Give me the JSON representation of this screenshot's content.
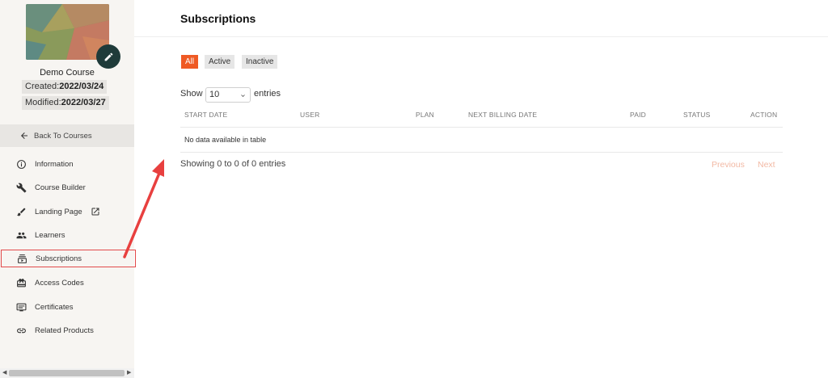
{
  "sidebar": {
    "course_name": "Demo Course",
    "created_label": "Created:",
    "created_date": "2022/03/24",
    "modified_label": "Modified:",
    "modified_date": "2022/03/27",
    "back_label": "Back To Courses",
    "items": [
      {
        "label": "Information",
        "icon": "info-icon"
      },
      {
        "label": "Course Builder",
        "icon": "wrench-icon"
      },
      {
        "label": "Landing Page",
        "icon": "brush-icon"
      },
      {
        "label": "Learners",
        "icon": "people-icon"
      },
      {
        "label": "Subscriptions",
        "icon": "subscriptions-icon"
      },
      {
        "label": "Access Codes",
        "icon": "ticket-icon"
      },
      {
        "label": "Certificates",
        "icon": "certificate-icon"
      },
      {
        "label": "Related Products",
        "icon": "link-icon"
      }
    ],
    "active_item": "Subscriptions"
  },
  "page": {
    "title": "Subscriptions"
  },
  "filters": [
    {
      "label": "All",
      "selected": true
    },
    {
      "label": "Active",
      "selected": false
    },
    {
      "label": "Inactive",
      "selected": false
    }
  ],
  "table": {
    "show_label": "Show",
    "entries_value": "10",
    "entries_label": "entries",
    "columns": [
      "START DATE",
      "USER",
      "PLAN",
      "NEXT BILLING DATE",
      "PAID",
      "STATUS",
      "ACTION"
    ],
    "empty_message": "No data available in table",
    "info": "Showing 0 to 0 of 0 entries",
    "previous_label": "Previous",
    "next_label": "Next"
  },
  "colors": {
    "accent": "#ef5a24",
    "highlight": "#e24a4a",
    "annotation_arrow": "#e8403f"
  }
}
